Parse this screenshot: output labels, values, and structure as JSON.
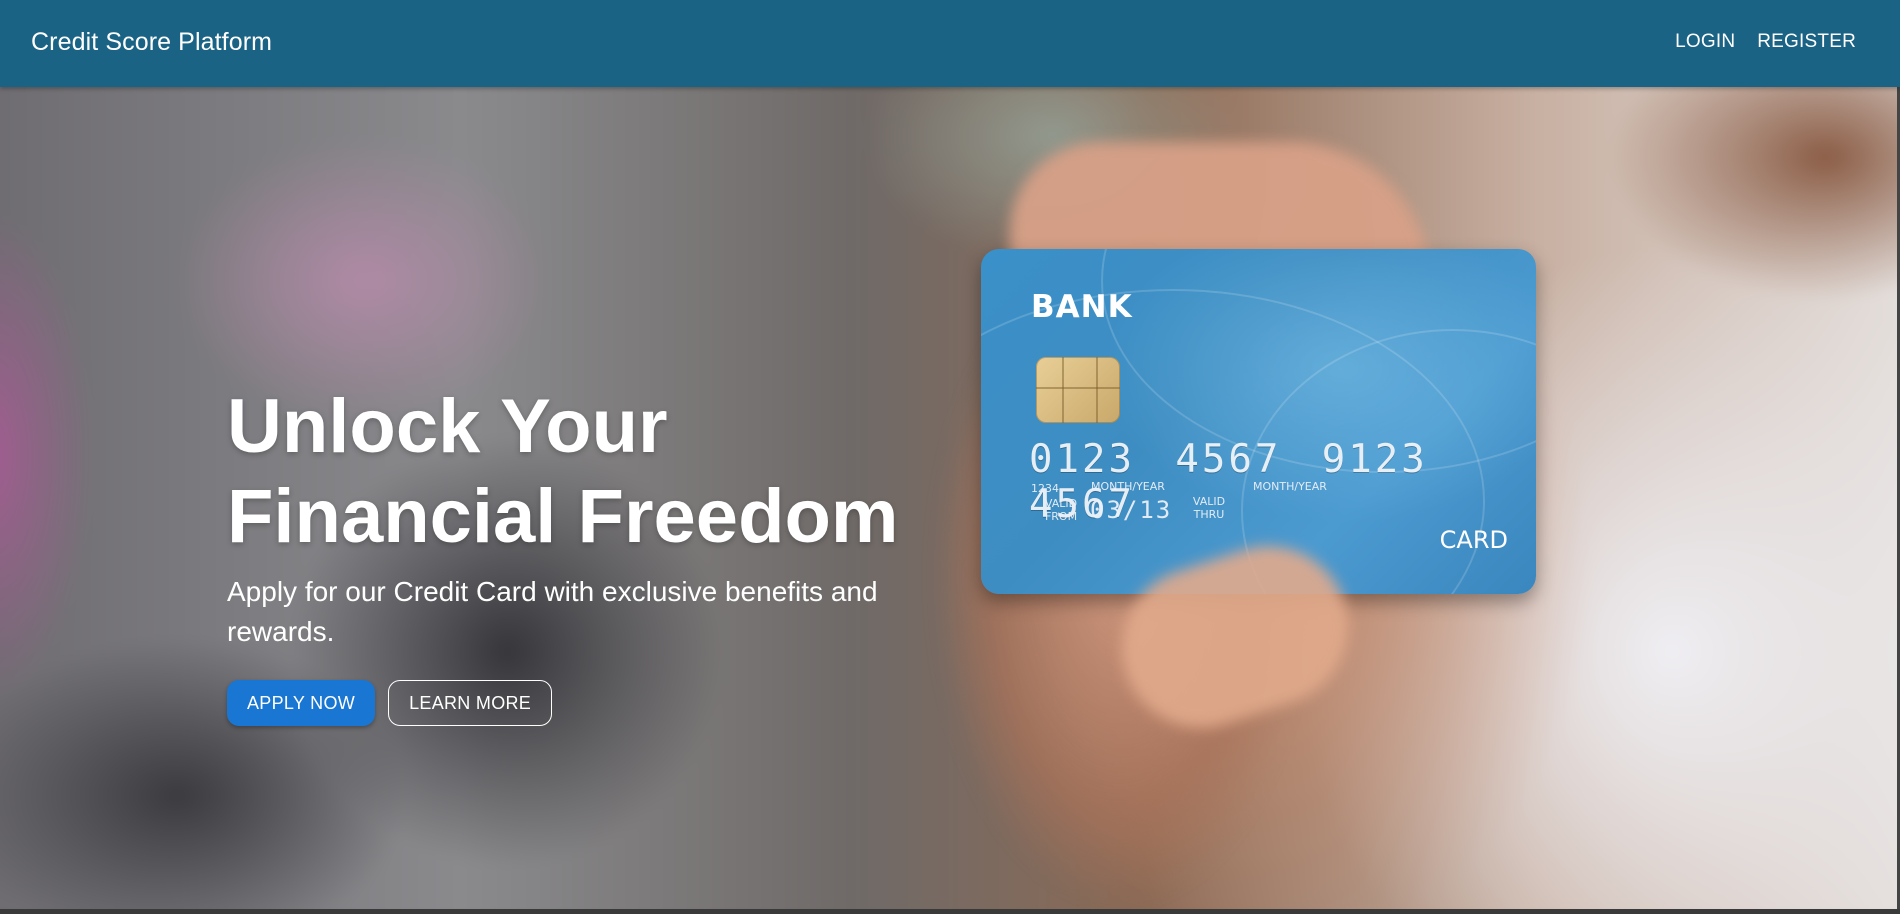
{
  "navbar": {
    "brand": "Credit Score Platform",
    "links": [
      "LOGIN",
      "REGISTER"
    ],
    "background_color": "#1a6385"
  },
  "hero": {
    "headline_line1": "Unlock Your",
    "headline_line2": "Financial Freedom",
    "subtext": "Apply for our Credit Card with exclusive benefits and rewards.",
    "primary_button": "APPLY NOW",
    "secondary_button": "LEARN MORE",
    "primary_color": "#1976d2"
  },
  "card_image": {
    "bank": "BANK",
    "number": "0123 4567 9123 4567",
    "small_number": "1234",
    "valid_from_label": "VALID FROM",
    "month_year_label_1": "MONTH/YEAR",
    "expiry": "03/13",
    "valid_thru_label": "VALID THRU",
    "month_year_label_2": "MONTH/YEAR",
    "card_label": "CARD"
  }
}
